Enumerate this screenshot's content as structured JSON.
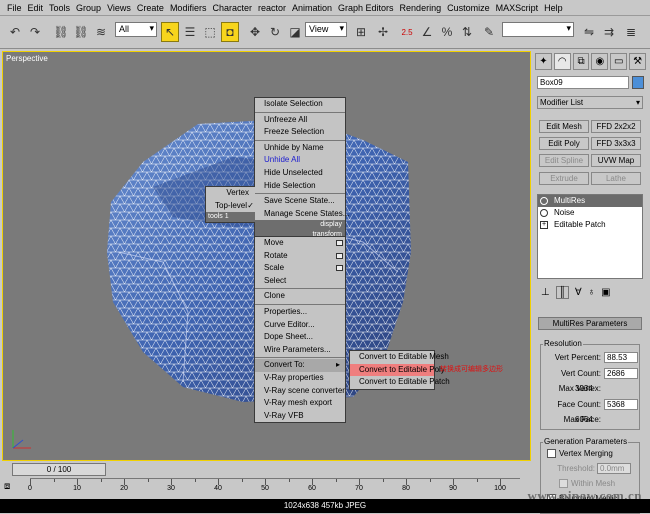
{
  "menubar": [
    "File",
    "Edit",
    "Tools",
    "Group",
    "Views",
    "Create",
    "Modifiers",
    "Character",
    "reactor",
    "Animation",
    "Graph Editors",
    "Rendering",
    "Customize",
    "MAXScript",
    "Help"
  ],
  "toolbar": {
    "selection_filter": "All",
    "ref_coord": "View",
    "angle_snap_label": "2.5",
    "percent_snap_label": "%"
  },
  "viewport": {
    "label": "Perspective"
  },
  "quad_menu": {
    "top_right": [
      "Isolate Selection",
      "Unfreeze All",
      "Freeze Selection",
      "Unhide by Name",
      "Unhide All",
      "Hide Unselected",
      "Hide Selection",
      "Save Scene State...",
      "Manage Scene States..."
    ],
    "display_header": "display",
    "transform_header": "transform",
    "tools_header": "tools 1",
    "top_left": [
      "Vertex",
      "Top-level"
    ],
    "bottom_right": [
      "Move",
      "Rotate",
      "Scale",
      "Select",
      "Clone",
      "Properties...",
      "Curve Editor...",
      "Dope Sheet...",
      "Wire Parameters...",
      "Convert To:",
      "V-Ray properties",
      "V-Ray scene converter",
      "V-Ray mesh export",
      "V-Ray VFB"
    ],
    "convert_submenu": [
      "Convert to Editable Mesh",
      "Convert to Editable Poly",
      "Convert to Editable Patch"
    ],
    "checkmark": "✓"
  },
  "annotation": "转换成可编辑多边形",
  "command_panel": {
    "object_name": "Box09",
    "modifier_list": "Modifier List",
    "buttons": [
      "Edit Mesh",
      "FFD 2x2x2",
      "Edit Poly",
      "FFD 3x3x3",
      "Edit Spline",
      "UVW Map",
      "Extrude",
      "Lathe"
    ],
    "stack": [
      "MultiRes",
      "Noise",
      "Editable Patch"
    ],
    "rollout_title": "MultiRes Parameters",
    "resolution_group": "Resolution",
    "params": [
      {
        "label": "Vert Percent:",
        "value": "88.53"
      },
      {
        "label": "Vert Count:",
        "value": "2686"
      },
      {
        "label": "Max Vertex:",
        "value": "3034"
      },
      {
        "label": "Face Count:",
        "value": "5368"
      },
      {
        "label": "Max Face:",
        "value": "6064"
      }
    ],
    "generation_group": "Generation Parameters",
    "vertex_merging": "Vertex Merging",
    "threshold_label": "Threshold:",
    "threshold_value": "0.0mm",
    "within_mesh": "Within Mesh",
    "boundary_metric": "Boundary Metric"
  },
  "timeline": {
    "frame_label": "0 / 100",
    "ticks": [
      "0",
      "10",
      "20",
      "30",
      "40",
      "50",
      "60",
      "70",
      "80",
      "90",
      "100"
    ]
  },
  "status": "1024x638  457kb  JPEG",
  "watermark": "www.pipaw.com.cn"
}
